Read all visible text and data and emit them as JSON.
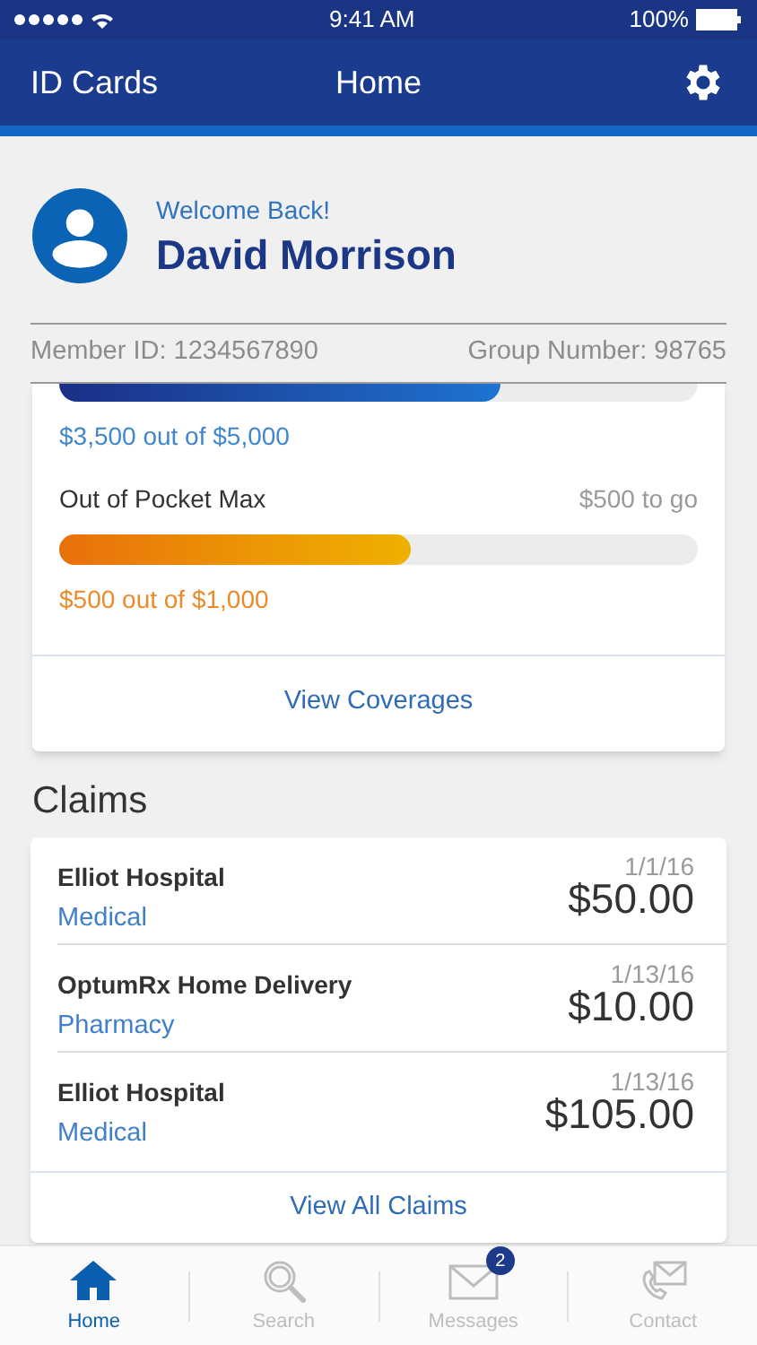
{
  "status_bar": {
    "time": "9:41 AM",
    "battery": "100%"
  },
  "nav": {
    "left": "ID Cards",
    "title": "Home"
  },
  "profile": {
    "greeting": "Welcome Back!",
    "name": "David Morrison",
    "member_id": "Member ID: 1234567890",
    "group_number": "Group Number: 98765"
  },
  "coverage": {
    "meters": [
      {
        "kind": "deductible",
        "level": 0.69,
        "reading": "$3,500 out of $5,000"
      },
      {
        "kind": "oop",
        "label": "Out of Pocket Max",
        "remaining": "$500 to go",
        "level": 0.55,
        "reading": "$500 out of $1,000"
      }
    ],
    "link": "View Coverages"
  },
  "claims": {
    "heading": "Claims",
    "rows": [
      {
        "provider": "Elliot Hospital",
        "type": "Medical",
        "date": "1/1/16",
        "amount": "$50.00"
      },
      {
        "provider": "OptumRx Home Delivery",
        "type": "Pharmacy",
        "date": "1/13/16",
        "amount": "$10.00"
      },
      {
        "provider": "Elliot Hospital",
        "type": "Medical",
        "date": "1/13/16",
        "amount": "$105.00"
      }
    ],
    "link": "View All Claims"
  },
  "tab_bar": [
    {
      "kind": "home",
      "label": "Home",
      "selected": true
    },
    {
      "kind": "search",
      "label": "Search",
      "selected": false
    },
    {
      "kind": "messages",
      "label": "Messages",
      "selected": false,
      "badge": "2"
    },
    {
      "kind": "contact",
      "label": "Contact",
      "selected": false
    }
  ]
}
